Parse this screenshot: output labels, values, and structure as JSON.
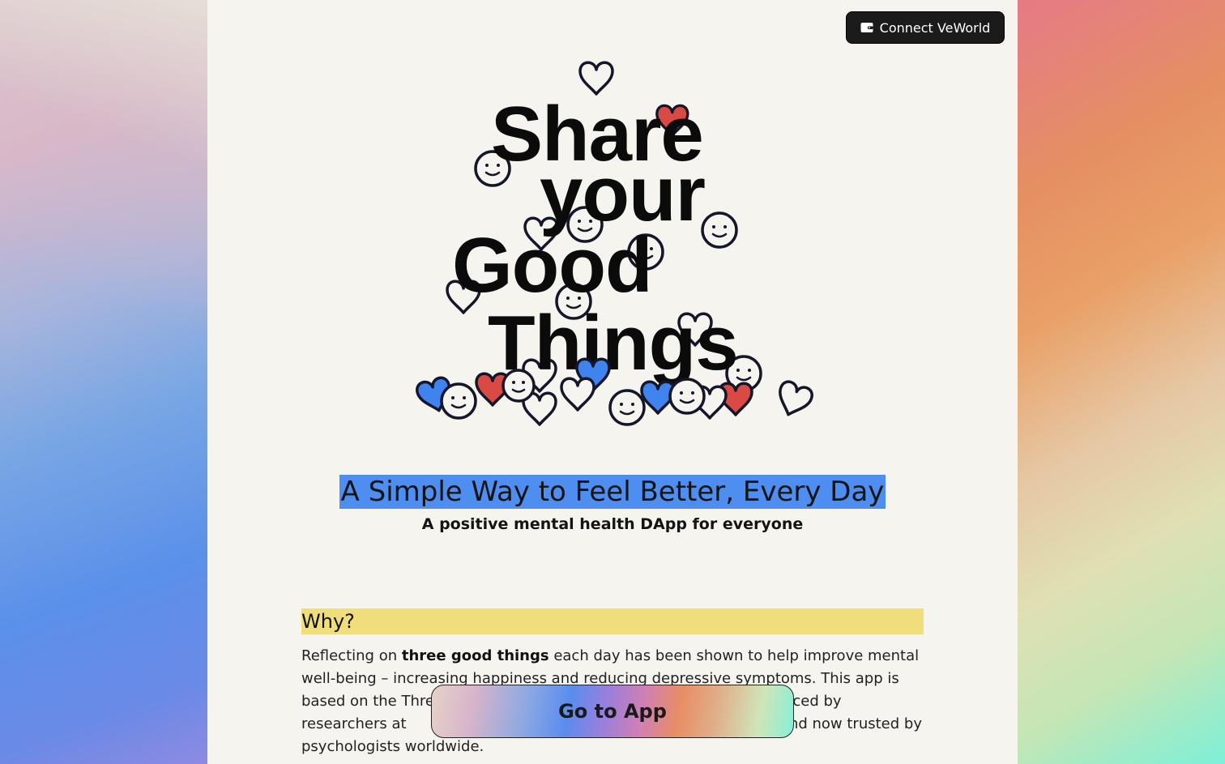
{
  "header": {
    "connect_label": "Connect VeWorld"
  },
  "hero": {
    "lines": [
      "Share",
      "your",
      "Good",
      "Things"
    ]
  },
  "subtitle": "A Simple Way to Feel Better, Every Day",
  "tagline": "A positive mental health DApp for everyone",
  "why": {
    "heading": "Why?",
    "p1_pre": "Reflecting on ",
    "p1_bold": "three good things",
    "p1_post": " each day has been shown to help improve mental well-being – increasing happiness and reducing depressive symptoms. This app is based on the Thre",
    "p1_mid": "rcise introduced by researchers at ",
    "p1_end": "05) and now trusted by psychologists worldwide."
  },
  "cta": {
    "go_label": "Go to App"
  },
  "colors": {
    "highlight_blue": "#4e8ef0",
    "highlight_yellow": "#f0dd7c",
    "heart_red": "#d94a45",
    "heart_blue": "#3f83ee"
  }
}
